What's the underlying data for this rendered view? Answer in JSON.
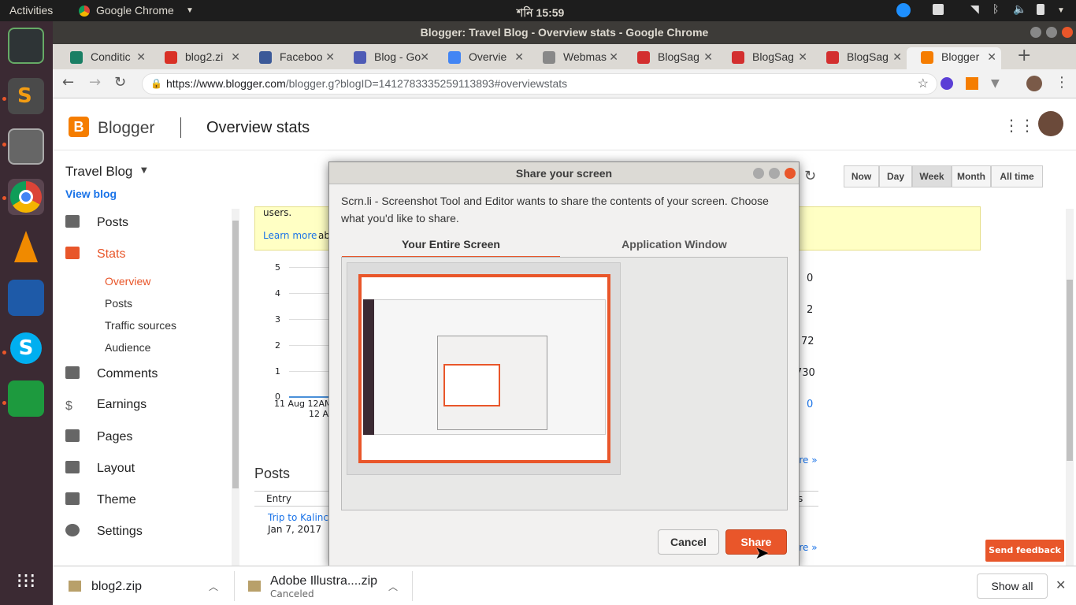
{
  "system": {
    "activities": "Activities",
    "app_name": "Google Chrome",
    "clock": "শনি 15:59"
  },
  "window": {
    "title": "Blogger: Travel Blog - Overview stats - Google Chrome"
  },
  "tabs": [
    {
      "label": "Conditic",
      "color": "#1a7f64"
    },
    {
      "label": "blog2.zi",
      "color": "#d93025"
    },
    {
      "label": "Faceboo",
      "color": "#3b5998"
    },
    {
      "label": "Blog - Go",
      "color": "#4e5bb6"
    },
    {
      "label": "Overvie",
      "color": "#4285f4"
    },
    {
      "label": "Webmas",
      "color": "#888888"
    },
    {
      "label": "BlogSag",
      "color": "#d32f2f"
    },
    {
      "label": "BlogSag",
      "color": "#d32f2f"
    },
    {
      "label": "BlogSag",
      "color": "#d32f2f"
    },
    {
      "label": "Blogger",
      "color": "#f57d00"
    }
  ],
  "url": {
    "host": "https://www.blogger.com",
    "path": "/blogger.g?blogID=1412783335259113893#overviewstats"
  },
  "blogger": {
    "brand": "Blogger",
    "page_title": "Overview stats",
    "blog_name": "Travel Blog",
    "view_blog": "View blog",
    "sidebar": {
      "posts": "Posts",
      "stats": "Stats",
      "overview": "Overview",
      "sub_posts": "Posts",
      "traffic": "Traffic sources",
      "audience": "Audience",
      "comments": "Comments",
      "earnings": "Earnings",
      "pages": "Pages",
      "layout": "Layout",
      "theme": "Theme",
      "settings": "Settings"
    },
    "ranges": [
      "Now",
      "Day",
      "Week",
      "Month",
      "All time"
    ],
    "notice_users": "users.",
    "learn_more": "Learn more",
    "learn_more_tail": "ab",
    "chart_yticks": [
      "5",
      "4",
      "3",
      "2",
      "1",
      "0"
    ],
    "chart_xlabel1": "11 Aug 12AM",
    "chart_xlabel2": "12 Au",
    "right_values": [
      "0",
      "2",
      "72",
      "730",
      "0"
    ],
    "more1": "ore »",
    "more2": "ore »",
    "posts_heading": "Posts",
    "entry_header": "Entry",
    "pageviews_header": "s",
    "post_title": "Trip to Kalinch",
    "post_date": "Jan 7, 2017",
    "send_feedback": "Send feedback"
  },
  "dialog": {
    "title": "Share your screen",
    "message": "Scrn.li - Screenshot Tool and Editor wants to share the contents of your screen. Choose what you'd like to share.",
    "tab_entire": "Your Entire Screen",
    "tab_window": "Application Window",
    "cancel": "Cancel",
    "share": "Share"
  },
  "downloads": {
    "item1": "blog2.zip",
    "item2": "Adobe Illustra....zip",
    "item2_status": "Canceled",
    "show_all": "Show all"
  }
}
